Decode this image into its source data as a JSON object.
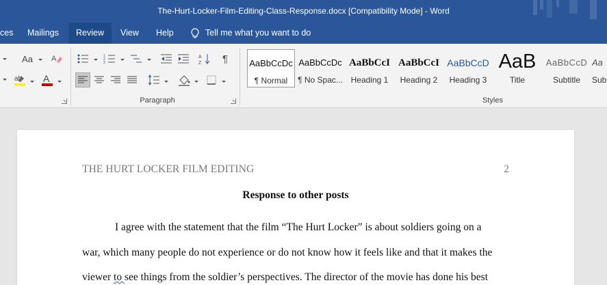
{
  "window": {
    "title": "The-Hurt-Locker-Film-Editing-Class-Response.docx [Compatibility Mode]  -  Word"
  },
  "tabs": [
    {
      "label": "ces"
    },
    {
      "label": "Mailings"
    },
    {
      "label": "Review",
      "active": true
    },
    {
      "label": "View"
    },
    {
      "label": "Help"
    }
  ],
  "tell_me": "Tell me what you want to do",
  "ribbon": {
    "paragraph_label": "Paragraph",
    "styles_label": "Styles",
    "font_size_label": "Aa",
    "styles": [
      {
        "preview": "AaBbCcDc",
        "name": "¶ Normal"
      },
      {
        "preview": "AaBbCcDc",
        "name": "¶ No Spac..."
      },
      {
        "preview": "AaBbCcI",
        "name": "Heading 1"
      },
      {
        "preview": "AaBbCcI",
        "name": "Heading 2"
      },
      {
        "preview": "AaBbCcD",
        "name": "Heading 3"
      },
      {
        "preview": "AaB",
        "name": "Title"
      },
      {
        "preview": "AaBbCcD",
        "name": "Subtitle"
      },
      {
        "preview": "Aa",
        "name": "Sub"
      }
    ]
  },
  "document": {
    "running_head": "THE HURT LOCKER FILM EDITING",
    "page_number": "2",
    "heading": "Response to other posts",
    "lines": [
      "I agree with the statement that the film “The Hurt Locker” is about soldiers going on a",
      "war, which many people do not experience or do not know how it feels like and that it makes the",
      "see things from the soldier’s perspectives. The director of the movie has done his best"
    ],
    "line3_prefix": "viewer ",
    "line3_squiggle": "to "
  },
  "colors": {
    "brand_blue": "#2b579a",
    "font_color_red": "#c00000",
    "highlight_yellow": "#ffeb3b"
  }
}
